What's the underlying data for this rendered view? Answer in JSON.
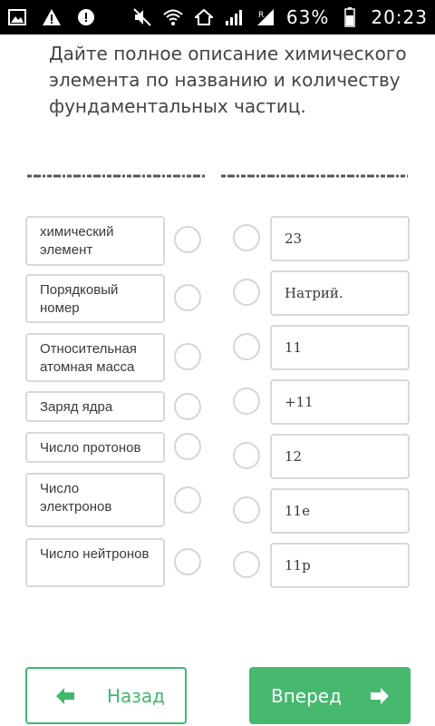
{
  "status_bar": {
    "battery_percent": "63%",
    "time": "20:23",
    "icons": [
      "image-icon",
      "warning-icon",
      "data-saver-icon",
      "mute-icon",
      "wifi-icon",
      "home-icon",
      "signal-icon",
      "signal-r-icon",
      "battery-icon"
    ]
  },
  "question": "Дайте полное описание химического элемента по названию и количеству фундаментальных частиц.",
  "left_items": [
    "химический элемент",
    "Порядковый номер",
    "Относительная атомная масса",
    "Заряд ядра",
    "Число протонов",
    "Число электронов",
    "Число нейтронов"
  ],
  "right_items": [
    "23",
    "Натрий.",
    "11",
    "+11",
    "12",
    "11e",
    "11p"
  ],
  "buttons": {
    "back": "Назад",
    "next": "Вперед"
  },
  "colors": {
    "accent": "#46b96f",
    "card_border": "#d8d8d8",
    "dash": "#555555"
  }
}
